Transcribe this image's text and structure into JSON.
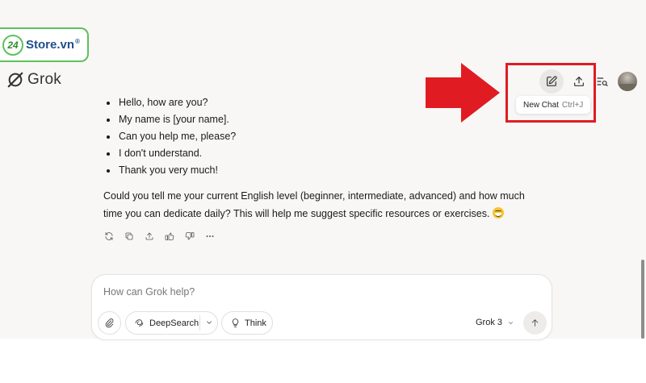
{
  "watermark": {
    "badge_number": "24",
    "store_name": "Store.vn",
    "registered": "®"
  },
  "brand": {
    "name": "Grok"
  },
  "toolbar": {
    "new_chat_tooltip": "New Chat",
    "new_chat_shortcut": "Ctrl+J"
  },
  "message": {
    "bullets": [
      "Hello, how are you?",
      "My name is [your name].",
      "Can you help me, please?",
      "I don't understand.",
      "Thank you very much!"
    ],
    "paragraph": "Could you tell me your current English level (beginner, intermediate, advanced) and how much time you can dedicate daily? This will help me suggest specific resources or exercises."
  },
  "composer": {
    "placeholder": "How can Grok help?",
    "deepsearch_label": "DeepSearch",
    "think_label": "Think",
    "model_label": "Grok 3"
  },
  "colors": {
    "highlight": "#e01c22",
    "badge_green": "#5cc25a",
    "badge_blue": "#1f4e8c",
    "app_background": "#f8f7f5"
  }
}
